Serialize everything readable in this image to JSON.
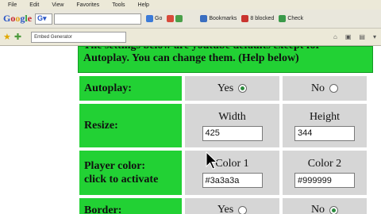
{
  "menubar": {
    "items": [
      "File",
      "Edit",
      "View",
      "Favorites",
      "Tools",
      "Help"
    ]
  },
  "google_toolbar": {
    "go_label": "Go",
    "bookmarks_label": "Bookmarks",
    "blocked_label": "8 blocked",
    "check_label": "Check"
  },
  "address_bar": {
    "tab_title": "Embed Generator"
  },
  "page": {
    "banner_line1": "The settings below are youtube defaults except for",
    "banner_line2": "Autoplay. You can change them. (Help below)",
    "rows": {
      "autoplay": {
        "label": "Autoplay:",
        "yes_label": "Yes",
        "no_label": "No",
        "selected": "Yes"
      },
      "resize": {
        "label": "Resize:",
        "width_label": "Width",
        "height_label": "Height",
        "width_value": "425",
        "height_value": "344"
      },
      "player_color": {
        "label_line1": "Player color:",
        "label_line2": "click to activate",
        "color1_label": "Color 1",
        "color2_label": "Color 2",
        "color1_value": "#3a3a3a",
        "color2_value": "#999999"
      },
      "border": {
        "label": "Border:",
        "yes_label": "Yes",
        "no_label": "No",
        "selected": "No"
      }
    }
  }
}
